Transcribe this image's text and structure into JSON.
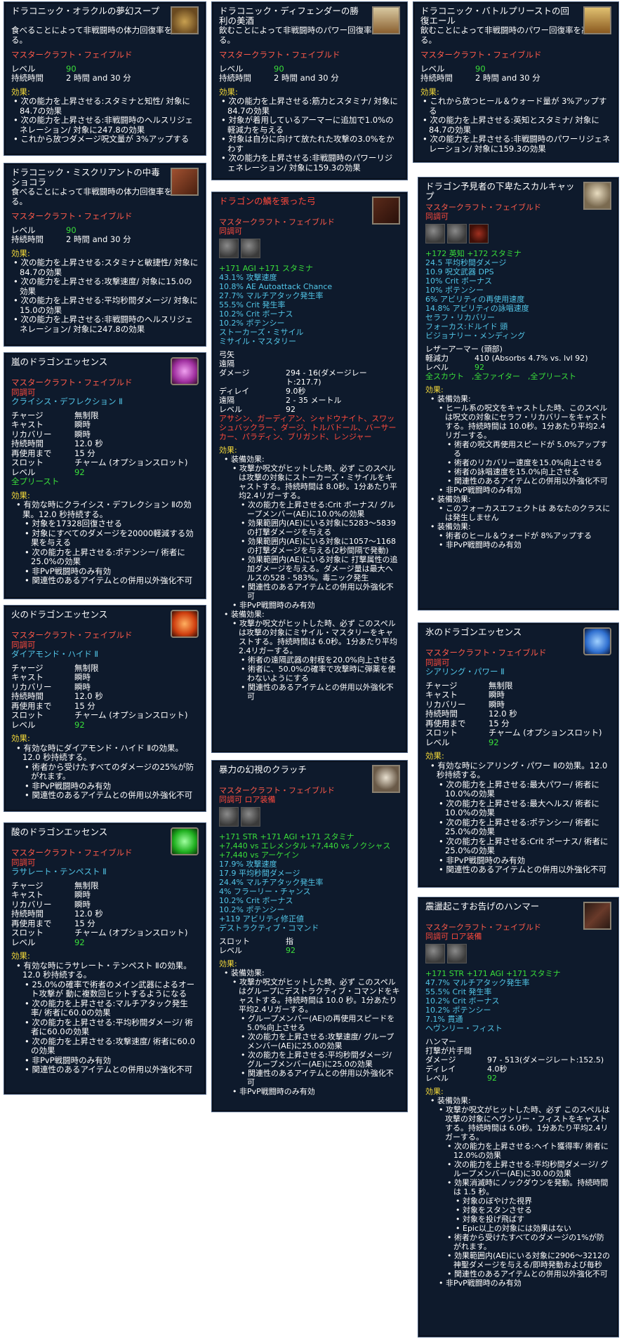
{
  "cards": [
    {
      "id": "card-oracle-soup",
      "title": "ドラコニック・オラクルの夢幻スープ",
      "desc": "食べることによって非戦闘時の体力回復率を高める。",
      "mastercraft": "マスタークラフト・フェイブルド",
      "level_label": "レベル",
      "level": "90",
      "duration_label": "持続時間",
      "duration": "2 時間 and 30 分",
      "effects_label": "効果:",
      "effects": [
        "次の能力を上昇させる:スタミナと知性/ 対象に84.7の効果",
        "次の能力を上昇させる:非戦闘時のヘルスリジェネレーション/ 対象に247.8の効果",
        "これから放つダメージ呪文量が 3%アップする"
      ]
    },
    {
      "id": "card-defender-mead",
      "title": "ドラコニック・ディフェンダーの勝利の美酒",
      "desc": "飲むことによって非戦闘時のパワー回復率を高める。",
      "mastercraft": "マスタークラフト・フェイブルド",
      "level_label": "レベル",
      "level": "90",
      "duration_label": "持続時間",
      "duration": "2 時間 and 30 分",
      "effects_label": "効果:",
      "effects": [
        "次の能力を上昇させる:筋力とスタミナ/ 対象に84.7の効果",
        "対象が着用しているアーマーに追加で1.0%の軽減力を与える",
        "対象は自分に向けて放たれた攻撃の3.0%をかわす",
        "次の能力を上昇させる:非戦闘時のパワーリジェネレーション/ 対象に159.3の効果"
      ]
    },
    {
      "id": "card-battlepriest-ale",
      "title": "ドラコニック・バトルプリーストの回復エール",
      "desc": "飲むことによって非戦闘時のパワー回復率を高める。",
      "mastercraft": "マスタークラフト・フェイブルド",
      "level_label": "レベル",
      "level": "90",
      "duration_label": "持続時間",
      "duration": "2 時間 and 30 分",
      "effects_label": "効果:",
      "effects": [
        "これから放つヒール＆ウォード量が 3%アップする",
        "次の能力を上昇させる:英知とスタミナ/ 対象に84.7の効果",
        "次の能力を上昇させる:非戦闘時のパワーリジェネレーション/ 対象に159.3の効果"
      ]
    },
    {
      "id": "card-miscreant-chocolate",
      "title": "ドラコニック・ミスクリアントの中毒ショコラ",
      "desc": "食べることによって非戦闘時の体力回復率を高める。",
      "mastercraft": "マスタークラフト・フェイブルド",
      "level_label": "レベル",
      "level": "90",
      "duration_label": "持続時間",
      "duration": "2 時間 and 30 分",
      "effects_label": "効果:",
      "effects": [
        "次の能力を上昇させる:スタミナと敏捷性/ 対象に84.7の効果",
        "次の能力を上昇させる:攻撃速度/ 対象に15.0の効果",
        "次の能力を上昇させる:平均秒間ダメージ/ 対象に15.0の効果",
        "次の能力を上昇させる:非戦闘時のヘルスリジェネレーション/ 対象に247.8の効果"
      ]
    }
  ],
  "bow": {
    "title": "ドラゴンの鱗を張った弓",
    "mastercraft": "マスタークラフト・フェイブルド",
    "attune": "同調可",
    "stats_green": "+171 AGI  +171 スタミナ",
    "stats_cyan": [
      "43.1% 攻撃速度",
      "10.8% AE Autoattack Chance",
      "27.7% マルチアタック発生率",
      "55.5% Crit 発生率",
      "10.2% Crit ボーナス",
      "10.2% ポテンシー",
      "ストーカーズ・ミサイル",
      "ミサイル・マスタリー"
    ],
    "type1": "弓矢",
    "type2": "遠隔",
    "rows": [
      {
        "k": "ダメージ",
        "v": "294 - 16(ダメージレート:217.7)"
      },
      {
        "k": "ディレイ",
        "v": "9.0秒"
      },
      {
        "k": "遠隔",
        "v": "2 - 35 メートル"
      },
      {
        "k": "レベル",
        "v": "92"
      }
    ],
    "classes": "アサシン、ガーディアン、シャドウナイト、スワッシュバックラー、ダージ、トルバドール、バーサーカー、パラディン、ブリガンド、レンジャー",
    "effects_label": "効果:",
    "effects": [
      {
        "lv": 1,
        "t": "装備効果:"
      },
      {
        "lv": 2,
        "t": "攻撃か呪文がヒットした時、必ず このスペルは攻撃の対象にストーカーズ・ミサイルをキャストする。持続時間は 8.0秒。1分あたり平均2.4リガーする。"
      },
      {
        "lv": 3,
        "t": "次の能力を上昇させる:Crit ボーナス/ グループメンバー(AE)に10.0%の効果"
      },
      {
        "lv": 3,
        "t": "効果範囲内(AE)にいる対象に5283〜5839の打撃ダメージを与える"
      },
      {
        "lv": 3,
        "t": "効果範囲内(AE)にいる対象に1057〜1168の打撃ダメージを与える(2秒間隔で発動)"
      },
      {
        "lv": 3,
        "t": "効果範囲内(AE)にいる対象に 打撃属性の追加ダメージを与える。ダメージ量は最大ヘルスの528 - 583%。毒ニック発生"
      },
      {
        "lv": 3,
        "t": "関連性のあるアイテムとの併用以外強化不可"
      },
      {
        "lv": 2,
        "t": "非PvP戦闘時のみ有効"
      },
      {
        "lv": 1,
        "t": "装備効果:"
      },
      {
        "lv": 2,
        "t": "攻撃か呪文がヒットした時、必ず このスペルは攻撃の対象にミサイル・マスタリーをキャストする。持続時間は 6.0秒。1分あたり平均2.4リガーする。"
      },
      {
        "lv": 3,
        "t": "術者の遠隔武器の射程を20.0%向上させる"
      },
      {
        "lv": 3,
        "t": "術者に、50.0%の確率で攻撃時に弾薬を使わないようにする"
      },
      {
        "lv": 3,
        "t": "関連性のあるアイテムとの併用以外強化不可"
      }
    ]
  },
  "skull_cap": {
    "title": "ドラゴン予見者の下卑たスカルキャップ",
    "mastercraft": "マスタークラフト・フェイブルド",
    "attune": "同調可",
    "stats_green": "+172 英知  +172 スタミナ",
    "stats_cyan": [
      "24.5 平均秒間ダメージ",
      "10.9 呪文武器 DPS",
      "10% Crit ボーナス",
      "10% ポテンシー",
      "6% アビリティの再使用速度",
      "14.8% アビリティの詠唱速度",
      "セラフ・リカバリー",
      "フォーカス:ドルイド 頭",
      "ビジョナリー・メンディング"
    ],
    "armor_type": "レザーアーマー (頭部)",
    "mitigation_label": "軽減力",
    "mitigation": "410 (Absorbs 4.7% vs. lvl 92)",
    "level_label": "レベル",
    "level": "92",
    "classes": "全スカウト　,全ファイター　,全プリースト",
    "effects_label": "効果:",
    "effects": [
      {
        "lv": 1,
        "t": "装備効果:"
      },
      {
        "lv": 2,
        "t": "ヒール系の呪文をキャストした時、このスペルは呪文の対象にセラフ・リカバリーをキャストする。持続時間は 10.0秒。1分あたり平均2.4リガーする。"
      },
      {
        "lv": 3,
        "t": "術者の呪文再使用スピードが 5.0%アップする"
      },
      {
        "lv": 3,
        "t": "術者のリカバリー速度を15.0%向上させる"
      },
      {
        "lv": 3,
        "t": "術者の詠唱速度を15.0%向上させる"
      },
      {
        "lv": 3,
        "t": "関連性のあるアイテムとの併用以外強化不可"
      },
      {
        "lv": 2,
        "t": "非PvP戦闘時のみ有効"
      },
      {
        "lv": 1,
        "t": "装備効果:"
      },
      {
        "lv": 2,
        "t": "このフォーカスエフェクトは あなたのクラスには発生しません"
      },
      {
        "lv": 1,
        "t": "装備効果:"
      },
      {
        "lv": 2,
        "t": "術者のヒール＆ウォードが 8%アップする"
      },
      {
        "lv": 2,
        "t": "非PvP戦闘時のみ有効"
      }
    ]
  },
  "essences": [
    {
      "id": "card-storm-essence",
      "title": "嵐のドラゴンエッセンス",
      "mastercraft": "マスタークラフト・フェイブルド",
      "attune": "同調可",
      "spell": "クライシス・デフレクション Ⅱ",
      "icon_color": "#d060c8",
      "rows": [
        {
          "k": "チャージ",
          "v": "無制限"
        },
        {
          "k": "キャスト",
          "v": "瞬時"
        },
        {
          "k": "リカバリー",
          "v": "瞬時"
        },
        {
          "k": "持続時間",
          "v": "12.0 秒"
        },
        {
          "k": "再使用まで",
          "v": "15 分"
        },
        {
          "k": "スロット",
          "v": "チャーム (オプションスロット)"
        }
      ],
      "level_label": "レベル",
      "level": "92",
      "classes": "全プリースト",
      "effects_label": "効果:",
      "effects": [
        {
          "lv": 1,
          "t": "有効な時にクライシス・デフレクション Ⅱの効果。12.0 秒持続する。"
        },
        {
          "lv": 2,
          "t": "対象を17328回復させる"
        },
        {
          "lv": 2,
          "t": "対象にすべてのダメージを20000軽減する効果を与える"
        },
        {
          "lv": 2,
          "t": "次の能力を上昇させる:ポテンシー/ 術者に25.0%の効果"
        },
        {
          "lv": 2,
          "t": "非PvP戦闘時のみ有効"
        },
        {
          "lv": 2,
          "t": "関連性のあるアイテムとの併用以外強化不可"
        }
      ]
    },
    {
      "id": "card-fire-essence",
      "title": "火のドラゴンエッセンス",
      "mastercraft": "マスタークラフト・フェイブルド",
      "attune": "同調可",
      "spell": "ダイアモンド・ハイド Ⅱ",
      "icon_color": "#e06020",
      "rows": [
        {
          "k": "チャージ",
          "v": "無制限"
        },
        {
          "k": "キャスト",
          "v": "瞬時"
        },
        {
          "k": "リカバリー",
          "v": "瞬時"
        },
        {
          "k": "持続時間",
          "v": "12.0 秒"
        },
        {
          "k": "再使用まで",
          "v": "15 分"
        },
        {
          "k": "スロット",
          "v": "チャーム (オプションスロット)"
        }
      ],
      "level_label": "レベル",
      "level": "92",
      "classes": "",
      "effects_label": "効果:",
      "effects": [
        {
          "lv": 1,
          "t": "有効な時にダイアモンド・ハイド Ⅱの効果。12.0 秒持続する。"
        },
        {
          "lv": 2,
          "t": "術者から受けたすべてのダメージの25%が防がれます。"
        },
        {
          "lv": 2,
          "t": "非PvP戦闘時のみ有効"
        },
        {
          "lv": 2,
          "t": "関連性のあるアイテムとの併用以外強化不可"
        }
      ]
    },
    {
      "id": "card-ice-essence",
      "title": "氷のドラゴンエッセンス",
      "mastercraft": "マスタークラフト・フェイブルド",
      "attune": "同調可",
      "spell": "シアリング・パワー Ⅱ",
      "icon_color": "#4a90e0",
      "rows": [
        {
          "k": "チャージ",
          "v": "無制限"
        },
        {
          "k": "キャスト",
          "v": "瞬時"
        },
        {
          "k": "リカバリー",
          "v": "瞬時"
        },
        {
          "k": "持続時間",
          "v": "12.0 秒"
        },
        {
          "k": "再使用まで",
          "v": "15 分"
        },
        {
          "k": "スロット",
          "v": "チャーム (オプションスロット)"
        }
      ],
      "level_label": "レベル",
      "level": "92",
      "classes": "",
      "effects_label": "効果:",
      "effects": [
        {
          "lv": 1,
          "t": "有効な時にシアリング・パワー Ⅱの効果。12.0 秒持続する。"
        },
        {
          "lv": 2,
          "t": "次の能力を上昇させる:最大パワー/ 術者に10.0%の効果"
        },
        {
          "lv": 2,
          "t": "次の能力を上昇させる:最大ヘルス/ 術者に10.0%の効果"
        },
        {
          "lv": 2,
          "t": "次の能力を上昇させる:ポテンシー/ 術者に25.0%の効果"
        },
        {
          "lv": 2,
          "t": "次の能力を上昇させる:Crit ボーナス/ 術者に25.0%の効果"
        },
        {
          "lv": 2,
          "t": "非PvP戦闘時のみ有効"
        },
        {
          "lv": 2,
          "t": "関連性のあるアイテムとの併用以外強化不可"
        }
      ]
    },
    {
      "id": "card-acid-essence",
      "title": "酸のドラゴンエッセンス",
      "mastercraft": "マスタークラフト・フェイブルド",
      "attune": "同調可",
      "spell": "ラサレート・テンペスト Ⅱ",
      "icon_color": "#30c030",
      "rows": [
        {
          "k": "チャージ",
          "v": "無制限"
        },
        {
          "k": "キャスト",
          "v": "瞬時"
        },
        {
          "k": "リカバリー",
          "v": "瞬時"
        },
        {
          "k": "持続時間",
          "v": "12.0 秒"
        },
        {
          "k": "再使用まで",
          "v": "15 分"
        },
        {
          "k": "スロット",
          "v": "チャーム (オプションスロット)"
        }
      ],
      "level_label": "レベル",
      "level": "92",
      "classes": "",
      "effects_label": "効果:",
      "effects": [
        {
          "lv": 1,
          "t": "有効な時にラサレート・テンペスト Ⅱの効果。12.0 秒持続する。"
        },
        {
          "lv": 2,
          "t": "25.0%の確率で術者のメイン武器によるオート攻撃が 動に複数回ヒットするようになる"
        },
        {
          "lv": 2,
          "t": "次の能力を上昇させる:マルチアタック発生率/ 術者に60.0の効果"
        },
        {
          "lv": 2,
          "t": "次の能力を上昇させる:平均秒間ダメージ/ 術者に60.0の効果"
        },
        {
          "lv": 2,
          "t": "次の能力を上昇させる:攻撃速度/ 術者に60.0の効果"
        },
        {
          "lv": 2,
          "t": "非PvP戦闘時のみ有効"
        },
        {
          "lv": 2,
          "t": "関連性のあるアイテムとの併用以外強化不可"
        }
      ]
    }
  ],
  "clutch": {
    "title": "暴力の幻視のクラッチ",
    "mastercraft": "マスタークラフト・フェイブルド",
    "attune": "同調可  ロア装備",
    "stats_green": [
      "+171 STR  +171 AGI  +171 スタミナ",
      "+7,440 vs エレメンタル  +7,440 vs ノクシャス  +7,440 vs アーケイン"
    ],
    "stats_cyan": [
      "17.9% 攻撃速度",
      "17.9 平均秒間ダメージ",
      "24.4% マルチアタック発生率",
      "4% フラーリー・チャンス",
      "10.2% Crit ボーナス",
      "10.2% ポテンシー",
      "+119 アビリティ修正値",
      "デストラクティブ・コマンド"
    ],
    "slot_label": "スロット",
    "slot": "指",
    "level_label": "レベル",
    "level": "92",
    "effects_label": "効果:",
    "effects": [
      {
        "lv": 1,
        "t": "装備効果:"
      },
      {
        "lv": 2,
        "t": "攻撃か呪文がヒットした時、必ず このスペルはグループにデストラクティブ・コマンドをキャストする。持続時間は 10.0 秒。1分あたり平均2.4リガーする。"
      },
      {
        "lv": 3,
        "t": "グループメンバー(AE)の再使用スピードを5.0%向上させる"
      },
      {
        "lv": 3,
        "t": "次の能力を上昇させる:攻撃速度/ グループメンバー(AE)に25.0の効果"
      },
      {
        "lv": 3,
        "t": "次の能力を上昇させる:平均秒間ダメージ/ グループメンバー(AE)に25.0の効果"
      },
      {
        "lv": 3,
        "t": "関連性のあるアイテムとの併用以外強化不可"
      },
      {
        "lv": 2,
        "t": "非PvP戦闘時のみ有効"
      }
    ]
  },
  "hammer": {
    "title": "震盪起こすお告げのハンマー",
    "mastercraft": "マスタークラフト・フェイブルド",
    "attune": "同調可  ロア装備",
    "stats_green": "+171 STR  +171 AGI  +171 スタミナ",
    "stats_cyan": [
      "47.7% マルチアタック発生率",
      "55.5% Crit 発生率",
      "10.2% Crit ボーナス",
      "10.2% ポテンシー",
      "7.1% 貫通",
      "ヘヴンリー・フィスト"
    ],
    "type1": "ハンマー",
    "type2": "打撃が片手間",
    "rows": [
      {
        "k": "ダメージ",
        "v": "97 - 513(ダメージレート:152.5)"
      },
      {
        "k": "ディレイ",
        "v": "4.0秒"
      },
      {
        "k": "レベル",
        "v": "92"
      }
    ],
    "effects_label": "効果:",
    "effects": [
      {
        "lv": 1,
        "t": "装備効果:"
      },
      {
        "lv": 2,
        "t": "攻撃か呪文がヒットした時、必ず このスペルは攻撃の対象にヘヴンリー・フィストをキャストする。持続時間は 6.0秒。1分あたり平均2.4リガーする。"
      },
      {
        "lv": 3,
        "t": "次の能力を上昇させる:ヘイト獲得率/ 術者に12.0%の効果"
      },
      {
        "lv": 3,
        "t": "次の能力を上昇させる:平均秒間ダメージ/ グループメンバー(AE)に30.0の効果"
      },
      {
        "lv": 3,
        "t": "効果消滅時にノックダウンを発動。持続時間は 1.5 秒。"
      },
      {
        "lv": 4,
        "t": "対象のぼやけた視界"
      },
      {
        "lv": 4,
        "t": "対象をスタンさせる"
      },
      {
        "lv": 4,
        "t": "対象を投げ飛ばす"
      },
      {
        "lv": 4,
        "t": "Epic以上の対象には効果はない"
      },
      {
        "lv": 3,
        "t": "術者から受けたすべてのダメージの1%が防がれます。"
      },
      {
        "lv": 3,
        "t": "効果範囲内(AE)にいる対象に2906〜3212の神聖ダメージを与える/即時発動および毎秒"
      },
      {
        "lv": 3,
        "t": "関連性のあるアイテムとの併用以外強化不可"
      },
      {
        "lv": 2,
        "t": "非PvP戦闘時のみ有効"
      }
    ]
  }
}
